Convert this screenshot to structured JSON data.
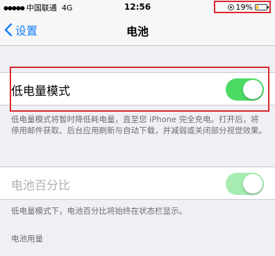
{
  "status_bar": {
    "carrier": "中国联通",
    "network": "4G",
    "time": "12:56",
    "battery_percent": "19%",
    "battery_level": 0.19,
    "battery_color": "#f5b400"
  },
  "nav": {
    "back_label": "设置",
    "title": "电池"
  },
  "low_power_mode": {
    "label": "低电量模式",
    "enabled": true,
    "footnote": "低电量模式将暂时降低耗电量，直至您 iPhone 完全充电。打开后，将停用邮件获取、后台应用刷新与自动下载，并减弱或关闭部分视觉效果。"
  },
  "battery_percentage": {
    "label": "电池百分比",
    "enabled": true,
    "disabled_state": true,
    "footnote": "低电量模式下，电池百分比将始终在状态栏显示。"
  },
  "battery_usage": {
    "header": "电池用量"
  },
  "colors": {
    "accent": "#147efb",
    "toggle_on": "#4cd964",
    "highlight": "#d8262b"
  }
}
